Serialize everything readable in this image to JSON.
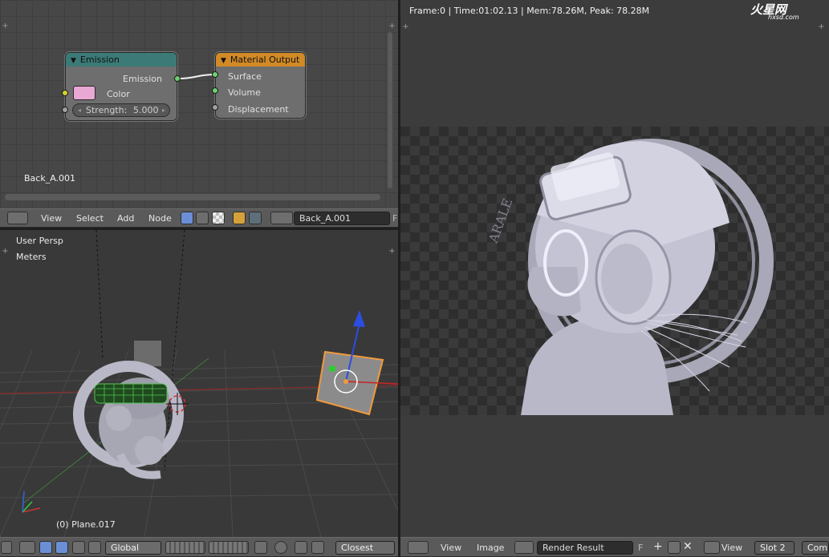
{
  "node_editor": {
    "material_name": "Back_A.001",
    "emission_node": {
      "title": "Emission",
      "output_label": "Emission",
      "color_label": "Color",
      "color_swatch": "#e9a7d4",
      "strength_label": "Strength:",
      "strength_value": "5.000",
      "header_color": "#3b7a76"
    },
    "output_node": {
      "title": "Material Output",
      "inputs": [
        "Surface",
        "Volume",
        "Displacement"
      ],
      "header_color": "#d18a26"
    }
  },
  "node_header": {
    "menu": [
      "View",
      "Select",
      "Add",
      "Node"
    ],
    "material_field": "Back_A.001",
    "fake_user": "F"
  },
  "viewport": {
    "view_label": "User Persp",
    "units_label": "Meters",
    "object_label": "(0) Plane.017"
  },
  "viewport_header": {
    "orientation": "Global",
    "snap_target": "Closest"
  },
  "image_editor": {
    "stats": "Frame:0 | Time:01:02.13 | Mem:78.26M, Peak: 78.28M",
    "watermark": "火星网",
    "watermark_sub": "hxsd.com",
    "ring_text": "ARALE"
  },
  "image_header": {
    "menu": [
      "View",
      "Image"
    ],
    "image_name": "Render Result",
    "fake_user": "F",
    "view_menu": "View",
    "slot": "Slot 2",
    "pass_truncated": "Com"
  }
}
